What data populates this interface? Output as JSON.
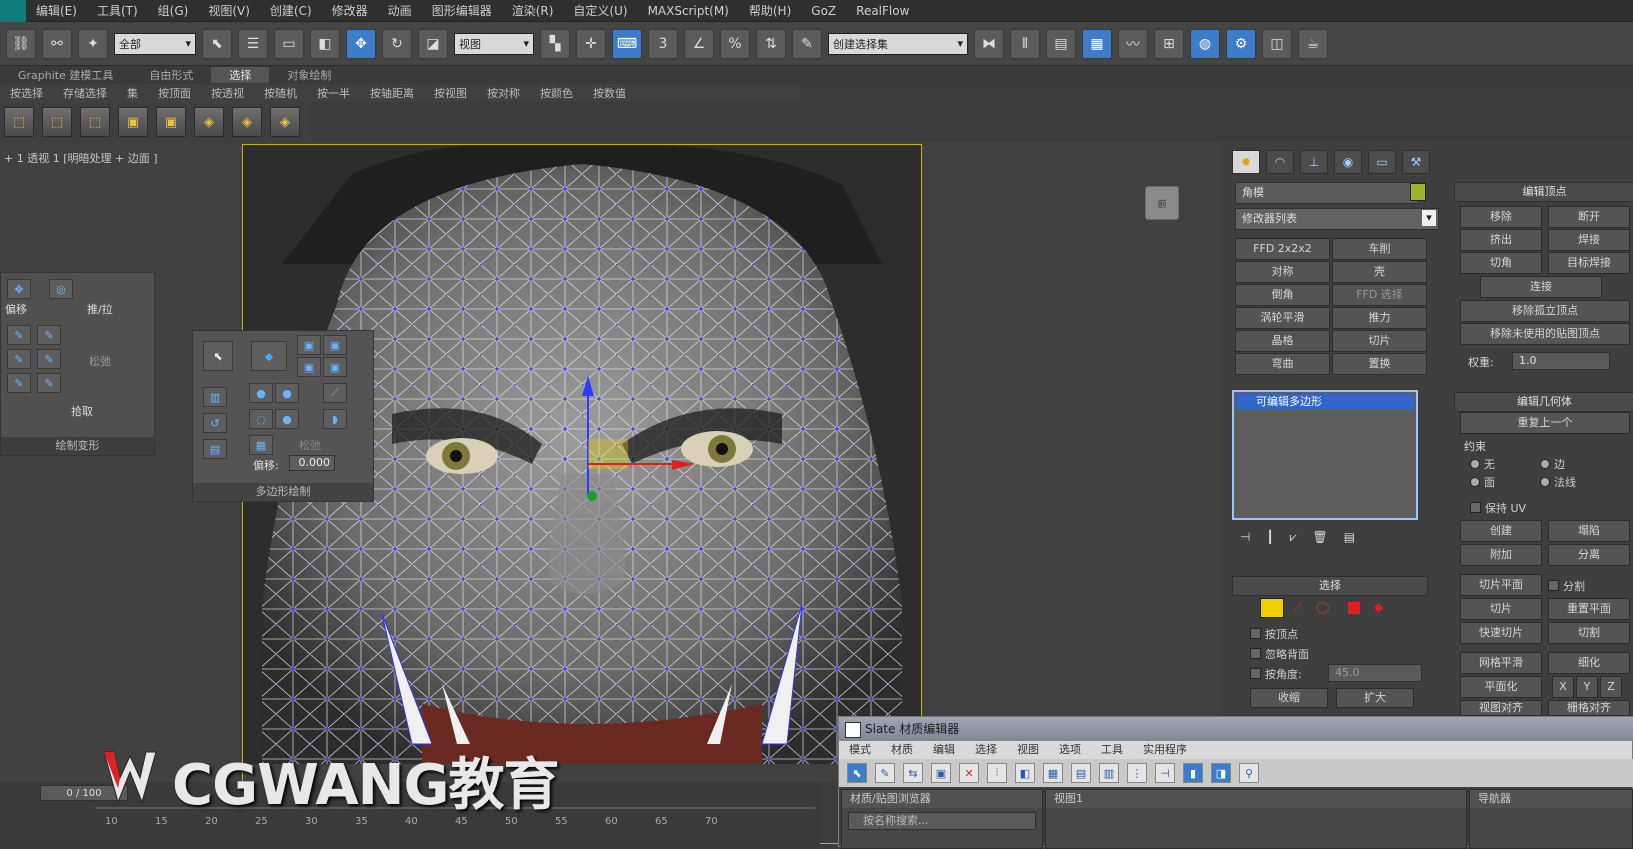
{
  "menubar": {
    "items": [
      "编辑(E)",
      "工具(T)",
      "组(G)",
      "视图(V)",
      "创建(C)",
      "修改器",
      "动画",
      "图形编辑器",
      "渲染(R)",
      "自定义(U)",
      "MAXScript(M)",
      "帮助(H)",
      "GoZ",
      "RealFlow"
    ]
  },
  "toolbar": {
    "selection_filter": "全部",
    "ref_coord": "视图",
    "named_selection": "创建选择集",
    "snap_label_3": "3",
    "percent_label": "%"
  },
  "ribbon": {
    "tabs": [
      "Graphite 建模工具",
      "自由形式",
      "选择",
      "对象绘制"
    ],
    "active_tab": "选择",
    "row2": [
      "按选择",
      "存储选择",
      "集",
      "按顶面",
      "按透视",
      "按随机",
      "按一半",
      "按轴距离",
      "按视图",
      "按对称",
      "按颜色",
      "按数值"
    ]
  },
  "viewport": {
    "label": "+ 1 透视 1 [明暗处理 + 边面 ]",
    "viewcube": "前"
  },
  "float_left": {
    "labels": {
      "shift": "偏移",
      "pushpull": "推/拉",
      "relax": "松弛",
      "pick": "拾取"
    },
    "caption": "绘制变形"
  },
  "float_mid": {
    "offset_label": "偏移:",
    "offset_value": "0.000",
    "opacity_label": "松弛",
    "caption": "多边形绘制"
  },
  "command_panel": {
    "object_name": "角模",
    "modifier_list": "修改器列表",
    "modifier_buttons": [
      "FFD 2x2x2",
      "车削",
      "对称",
      "壳",
      "倒角",
      "FFD 选择",
      "涡轮平滑",
      "推力",
      "晶格",
      "切片",
      "弯曲",
      "置换"
    ],
    "stack_item": "可编辑多边形",
    "selection_title": "选择",
    "selection_checks": [
      "按顶点",
      "忽略背面",
      "按角度:"
    ],
    "angle_value": "45.0",
    "shrink": "收缩",
    "grow": "扩大",
    "edit_vertices_title": "编辑顶点",
    "ev_buttons": [
      "移除",
      "断开",
      "挤出",
      "焊接",
      "切角",
      "目标焊接",
      "连接"
    ],
    "remove_isolated": "移除孤立顶点",
    "remove_unused": "移除未使用的贴图顶点",
    "weight_label": "权重:",
    "weight_value": "1.0",
    "edit_geometry_title": "编辑几何体",
    "repeat_last": "重复上一个",
    "constraints_label": "约束",
    "constraints": [
      "无",
      "边",
      "面",
      "法线"
    ],
    "preserve_uv": "保持 UV",
    "eg_buttons": [
      "创建",
      "塌陷",
      "附加",
      "分离",
      "切片平面",
      "分割",
      "切片",
      "重置平面",
      "快速切片",
      "切割",
      "网格平滑",
      "细化",
      "平面化",
      "视图对齐",
      "栅格对齐"
    ],
    "xyz": [
      "X",
      "Y",
      "Z"
    ]
  },
  "timeline": {
    "frame": "0 / 100",
    "ticks": [
      "10",
      "15",
      "20",
      "25",
      "30",
      "35",
      "40",
      "45",
      "50",
      "55",
      "60",
      "65",
      "70"
    ]
  },
  "watermark": {
    "text": "CGWANG教育"
  },
  "slate": {
    "title": "Slate 材质编辑器",
    "menu": [
      "模式",
      "材质",
      "编辑",
      "选择",
      "视图",
      "选项",
      "工具",
      "实用程序"
    ],
    "browser_title": "材质/贴图浏览器",
    "search_placeholder": "按名称搜索...",
    "view_tab": "视图1",
    "navigator_title": "导航器"
  },
  "colors": {
    "accent_blue": "#3d7cc9",
    "frame_yellow": "#c8b400",
    "mesh_wire": "#ffffff",
    "vertex_blue": "#4040ff"
  }
}
